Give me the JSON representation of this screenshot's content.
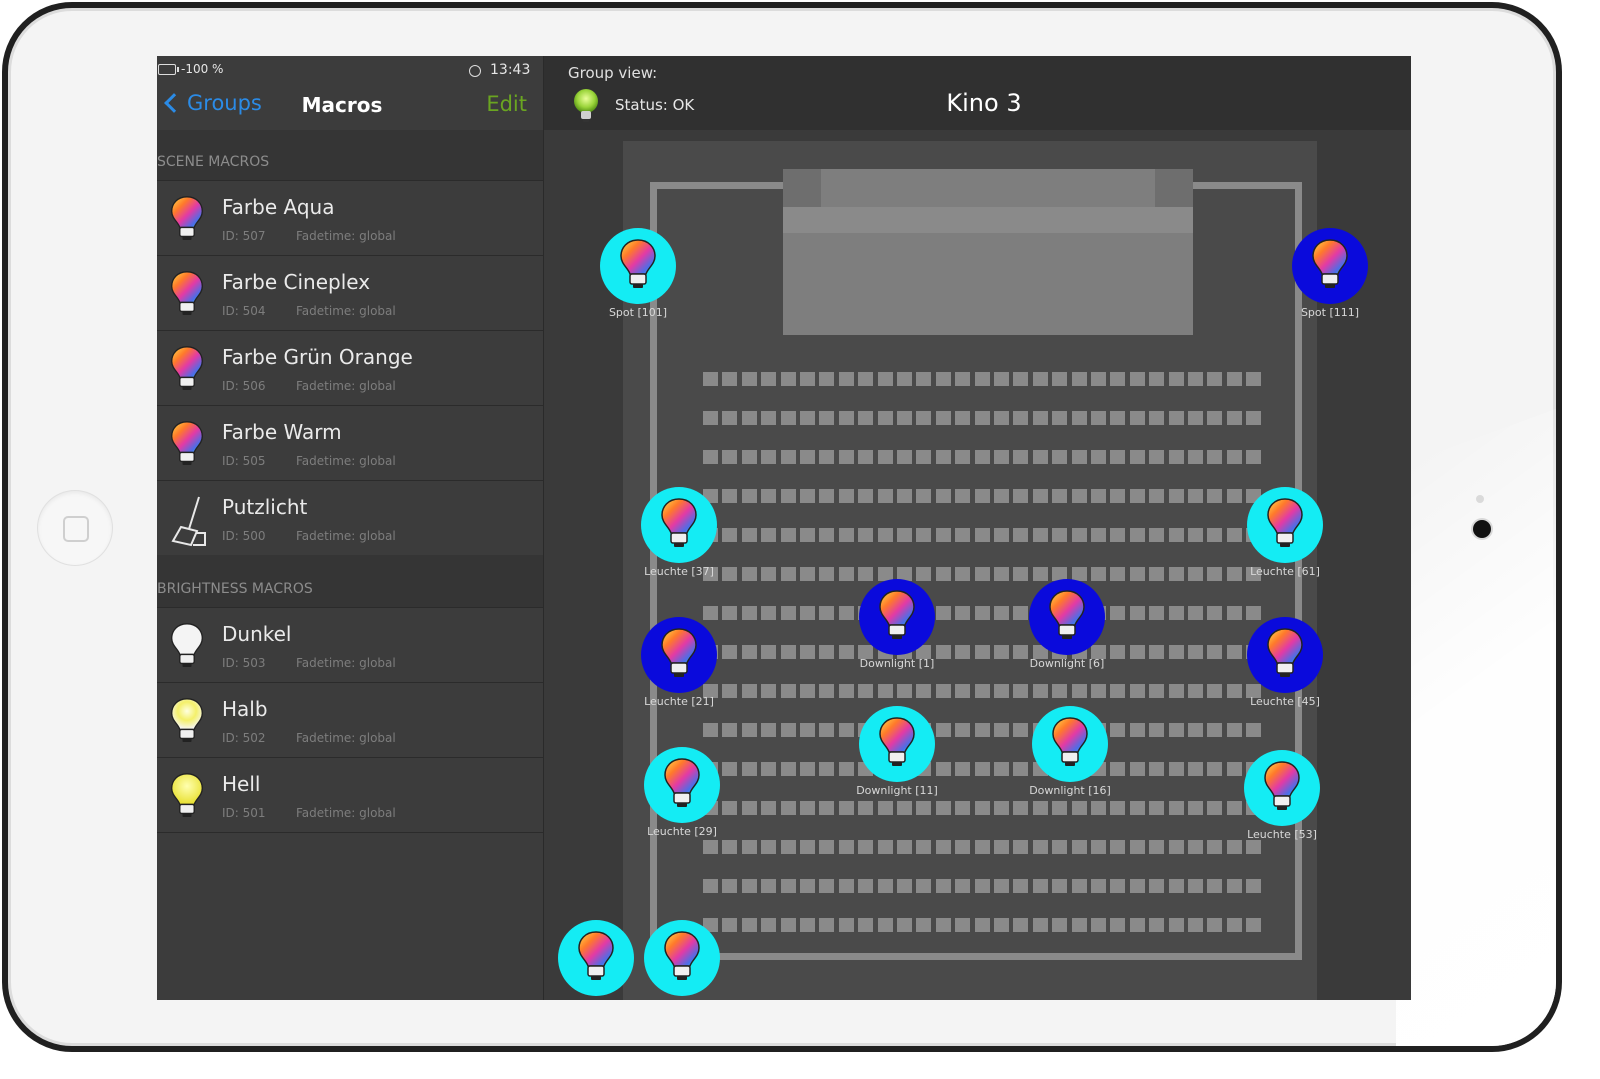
{
  "statusbar": {
    "battery": "-100 %",
    "time": "13:43"
  },
  "navbar": {
    "back_label": "Groups",
    "title": "Macros",
    "edit_label": "Edit"
  },
  "sections": {
    "scene": "SCENE MACROS",
    "brightness": "BRIGHTNESS MACROS"
  },
  "scene_macros": [
    {
      "name": "Farbe Aqua",
      "id": "ID: 507",
      "fadetime": "Fadetime: global",
      "icon": "color-bulb-icon"
    },
    {
      "name": "Farbe Cineplex",
      "id": "ID: 504",
      "fadetime": "Fadetime: global",
      "icon": "color-bulb-icon"
    },
    {
      "name": "Farbe Grün Orange",
      "id": "ID: 506",
      "fadetime": "Fadetime: global",
      "icon": "color-bulb-icon"
    },
    {
      "name": "Farbe Warm",
      "id": "ID: 505",
      "fadetime": "Fadetime: global",
      "icon": "color-bulb-icon"
    },
    {
      "name": "Putzlicht",
      "id": "ID: 500",
      "fadetime": "Fadetime: global",
      "icon": "broom-icon"
    }
  ],
  "brightness_macros": [
    {
      "name": "Dunkel",
      "id": "ID: 503",
      "fadetime": "Fadetime: global",
      "icon": "white-bulb-icon"
    },
    {
      "name": "Halb",
      "id": "ID: 502",
      "fadetime": "Fadetime: global",
      "icon": "half-bulb-icon"
    },
    {
      "name": "Hell",
      "id": "ID: 501",
      "fadetime": "Fadetime: global",
      "icon": "yellow-bulb-icon"
    }
  ],
  "group": {
    "view_label": "Group view:",
    "status": "Status: OK",
    "title": "Kino 3"
  },
  "lamps": [
    {
      "label": "Spot [101]",
      "state": "cyan"
    },
    {
      "label": "Spot [111]",
      "state": "blue"
    },
    {
      "label": "Leuchte [37]",
      "state": "cyan"
    },
    {
      "label": "Leuchte [61]",
      "state": "cyan"
    },
    {
      "label": "Downlight [1]",
      "state": "blue"
    },
    {
      "label": "Downlight [6]",
      "state": "blue"
    },
    {
      "label": "Leuchte [21]",
      "state": "blue"
    },
    {
      "label": "Leuchte [45]",
      "state": "blue"
    },
    {
      "label": "Downlight [11]",
      "state": "cyan"
    },
    {
      "label": "Downlight [16]",
      "state": "cyan"
    },
    {
      "label": "Leuchte [29]",
      "state": "cyan"
    },
    {
      "label": "Leuchte [53]",
      "state": "cyan"
    },
    {
      "label": "",
      "state": "cyan"
    },
    {
      "label": "",
      "state": "cyan"
    }
  ],
  "colors": {
    "accent_blue": "#2b8be6",
    "edit_green": "#6aa521",
    "lamp_on": "#14ecf4",
    "lamp_off": "#0a0adc"
  }
}
